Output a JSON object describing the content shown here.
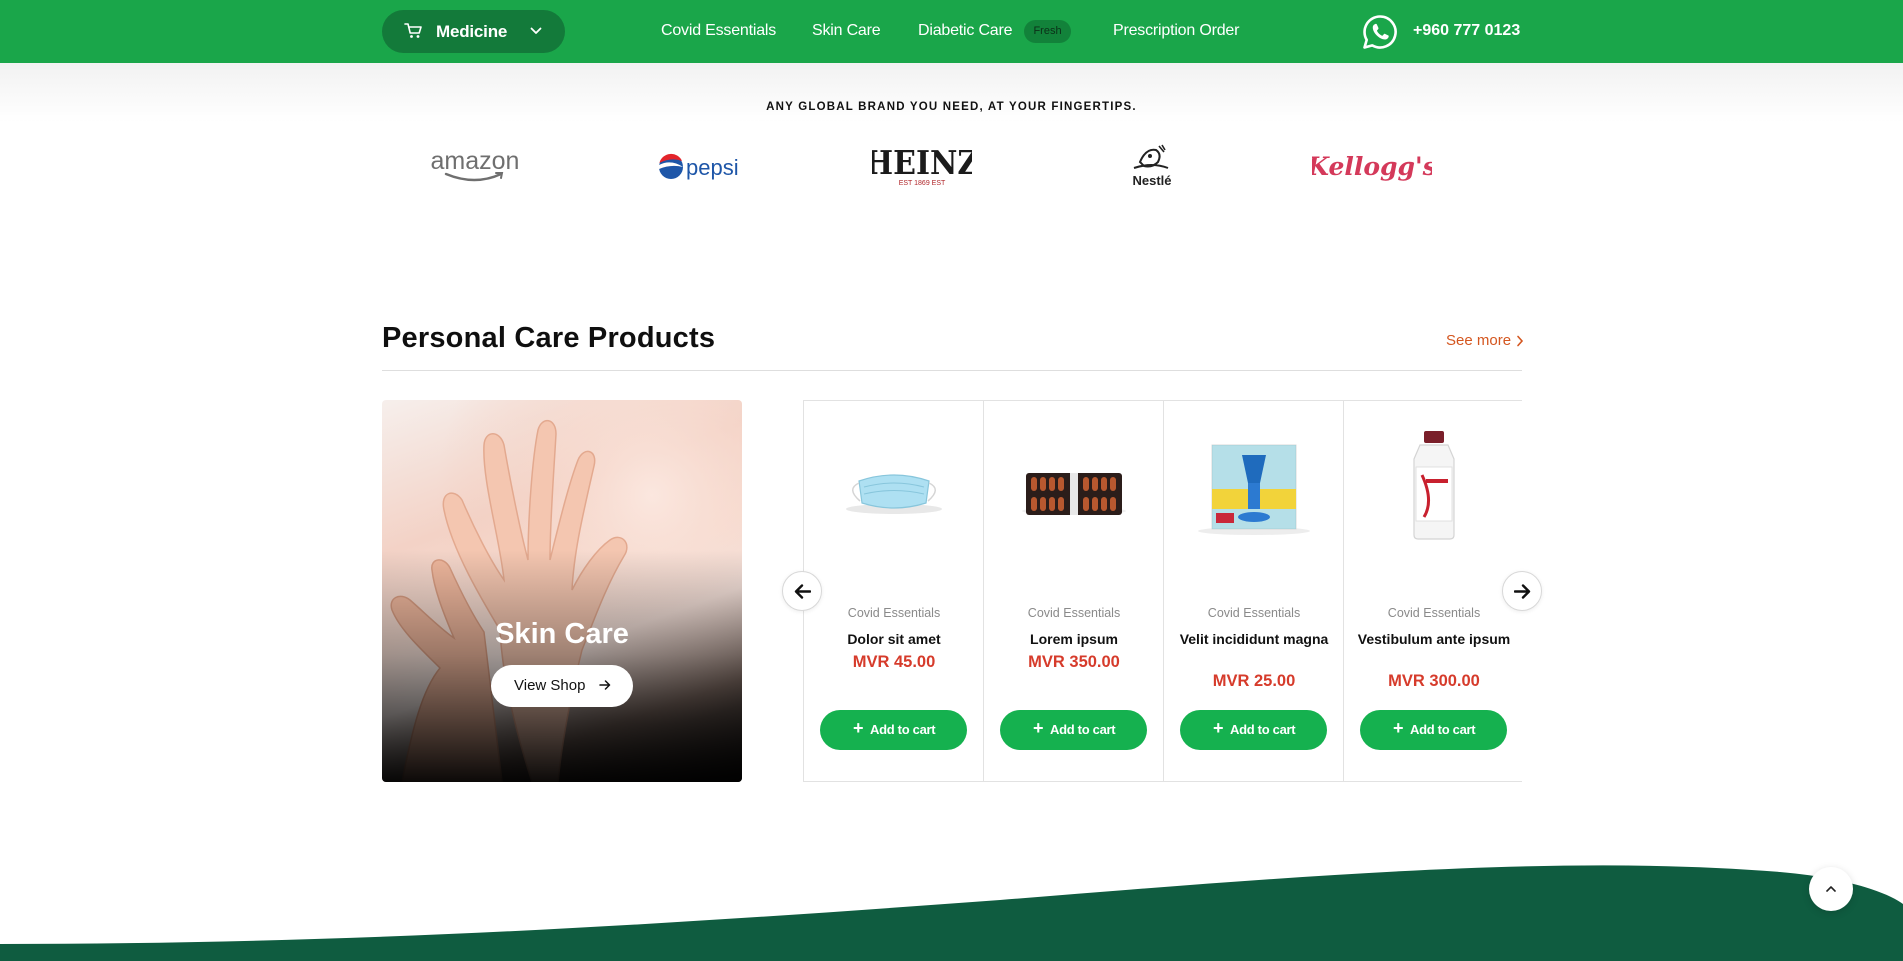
{
  "topbar": {
    "menu_label": "Medicine",
    "menu_icon": "cart-icon",
    "nav": [
      {
        "label": "Covid Essentials"
      },
      {
        "label": "Skin Care"
      },
      {
        "label": "Diabetic Care",
        "badge": "Fresh"
      },
      {
        "label": "Prescription Order"
      }
    ],
    "phone": "+960 777 0123",
    "phone_icon": "whatsapp-icon",
    "bar_color": "#1aa64a"
  },
  "brands": {
    "tagline": "ANY GLOBAL BRAND YOU NEED, AT YOUR FINGERTIPS.",
    "logos": [
      {
        "text": "amazon"
      },
      {
        "text": "pepsi"
      },
      {
        "text": "HEINZ",
        "sub": "EST 1869 EST"
      },
      {
        "text": "Nestlé"
      },
      {
        "text": "Kellogg's"
      }
    ]
  },
  "section": {
    "title": "Personal Care Products",
    "see_more": "See more"
  },
  "banner": {
    "title": "Skin Care",
    "button": "View Shop"
  },
  "products": [
    {
      "category": "Covid Essentials",
      "name": "Dolor sit amet",
      "price": "MVR 45.00",
      "image": "face-mask-image",
      "button": "Add to cart"
    },
    {
      "category": "Covid Essentials",
      "name": "Lorem ipsum",
      "price": "MVR 350.00",
      "image": "capsule-strip-image",
      "button": "Add to cart"
    },
    {
      "category": "Covid Essentials",
      "name": "Velit incididunt magna",
      "price": "MVR 25.00",
      "image": "vaporizer-box-image",
      "button": "Add to cart"
    },
    {
      "category": "Covid Essentials",
      "name": "Vestibulum ante ipsum",
      "price": "MVR 300.00",
      "image": "lotion-bottle-image",
      "button": "Add to cart"
    }
  ],
  "colors": {
    "accent_green": "#15b14f",
    "price_red": "#d63b2b",
    "see_more_orange": "#d4561f",
    "footer_green": "#0f5c40"
  }
}
